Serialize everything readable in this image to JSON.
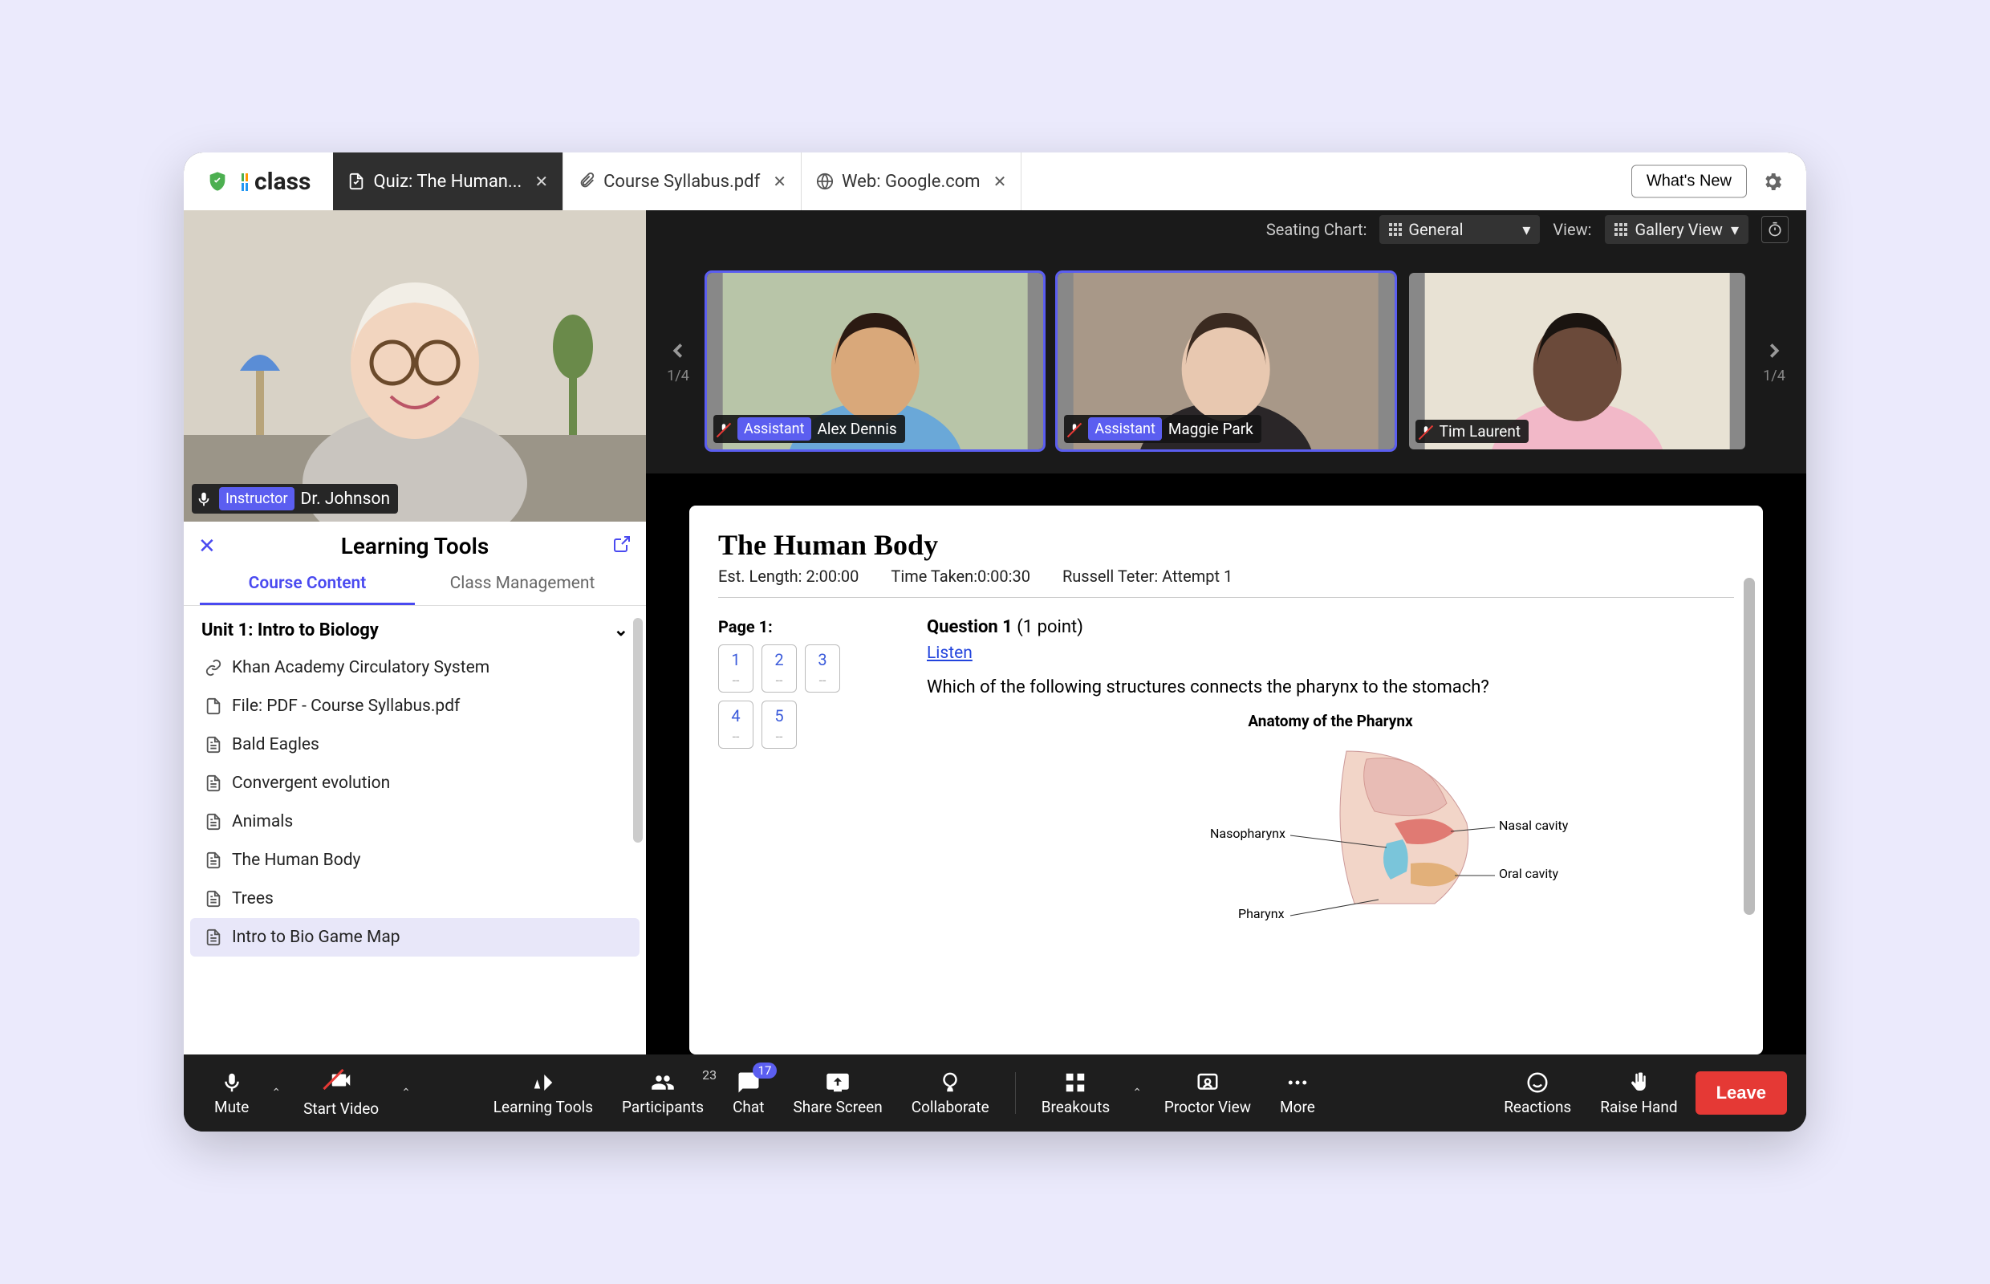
{
  "brand": {
    "name": "class"
  },
  "top_bar": {
    "tabs": [
      {
        "label": "Quiz: The Human...",
        "icon": "document"
      },
      {
        "label": "Course Syllabus.pdf",
        "icon": "attachment"
      },
      {
        "label": "Web: Google.com",
        "icon": "globe"
      }
    ],
    "whats_new": "What's New"
  },
  "dark_strip": {
    "seating_label": "Seating Chart:",
    "seating_value": "General",
    "view_label": "View:",
    "view_value": "Gallery View"
  },
  "instructor": {
    "role": "Instructor",
    "name": "Dr. Johnson"
  },
  "gallery": {
    "page_left": "1/4",
    "page_right": "1/4",
    "tiles": [
      {
        "role": "Assistant",
        "name": "Alex Dennis",
        "muted": true,
        "ring": true
      },
      {
        "role": "Assistant",
        "name": "Maggie Park",
        "muted": true,
        "ring": true
      },
      {
        "role": "",
        "name": "Tim Laurent",
        "muted": true,
        "ring": false
      }
    ]
  },
  "learning_tools": {
    "title": "Learning Tools",
    "tabs": {
      "content": "Course Content",
      "management": "Class Management"
    },
    "unit_title": "Unit 1: Intro to Biology",
    "items": [
      {
        "icon": "link",
        "label": "Khan Academy Circulatory System"
      },
      {
        "icon": "file",
        "label": "File: PDF - Course Syllabus.pdf"
      },
      {
        "icon": "file-text",
        "label": "Bald Eagles"
      },
      {
        "icon": "file-text",
        "label": "Convergent evolution"
      },
      {
        "icon": "file-text",
        "label": "Animals"
      },
      {
        "icon": "file-text",
        "label": "The Human Body"
      },
      {
        "icon": "file-text",
        "label": "Trees"
      },
      {
        "icon": "file-text",
        "label": "Intro to Bio Game Map",
        "selected": true
      }
    ]
  },
  "quiz": {
    "title": "The Human Body",
    "est_length_label": "Est. Length:",
    "est_length": "2:00:00",
    "time_taken_label": "Time Taken:",
    "time_taken": "0:00:30",
    "attempt": "Russell Teter: Attempt 1",
    "page_label": "Page 1:",
    "q_numbers": [
      "1",
      "2",
      "3",
      "4",
      "5"
    ],
    "q_number": "Question 1",
    "q_points": "(1 point)",
    "listen": "Listen",
    "q_text": "Which of the following structures connects the pharynx to the stomach?",
    "diagram_title": "Anatomy of the Pharynx",
    "labels": {
      "naso": "Nasopharynx",
      "nasal": "Nasal cavity",
      "oral": "Oral cavity",
      "pharynx": "Pharynx"
    }
  },
  "bottom": {
    "mute": "Mute",
    "start_video": "Start Video",
    "learning_tools": "Learning Tools",
    "participants": "Participants",
    "participants_count": "23",
    "chat": "Chat",
    "chat_count": "17",
    "share_screen": "Share Screen",
    "collaborate": "Collaborate",
    "breakouts": "Breakouts",
    "proctor_view": "Proctor View",
    "more": "More",
    "reactions": "Reactions",
    "raise_hand": "Raise Hand",
    "leave": "Leave"
  }
}
